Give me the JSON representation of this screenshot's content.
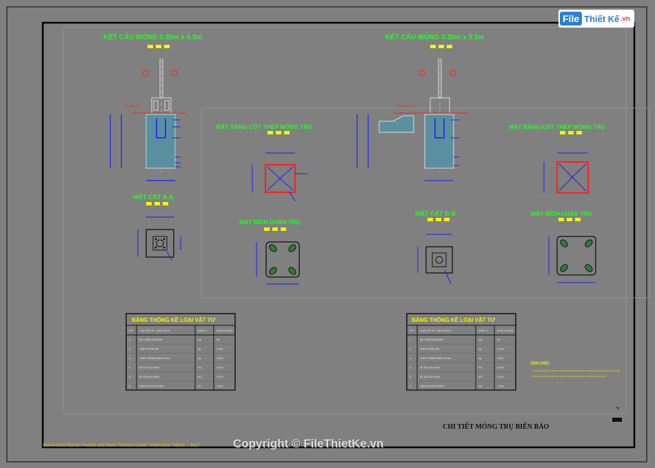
{
  "logo": {
    "brand_a": "File",
    "brand_b": "Thiết Kế",
    "brand_c": ".vn"
  },
  "watermark": "Copyright © FileThietKe.vn",
  "footer_title": "CHI TIẾT MÓNG TRỤ BIỂN BÁO",
  "status_line": "\\Ref H:\\NGUYEN BA THANG 2017\\DAU TIENG\\3 CONG TRINH DAU TIENG ... 2017",
  "left_sheet": {
    "title": "KẾT CẤU MÓNG 0.35m x 0.3m",
    "section_aa": "MẶT CẮT A-A",
    "plan_rebar": "MẶT BẰNG CỐT THÉP MÓNG TRỤ",
    "plan_base": "MẶT BÍCH CHÂN TRỤ",
    "table_title": "BẢNG THỐNG KÊ LOẠI VẬT TƯ"
  },
  "right_sheet": {
    "title": "KẾT CẤU MÓNG 0.35m x 0.3m",
    "section_bb": "MẶT CẮT B-B",
    "plan_rebar": "MẶT BẰNG CỐT THÉP MÓNG TRỤ",
    "plan_base": "MẶT BÍCH CHÂN TRỤ",
    "table_title": "BẢNG THỐNG KÊ LOẠI VẬT TƯ",
    "notes_title": "GHI CHÚ:"
  },
  "table_headers": [
    "STT",
    "LOẠI VẬT TƯ - QUY CÁCH",
    "ĐƠN VỊ",
    "KHỐI LƯỢNG"
  ],
  "table_rows": [
    [
      "1",
      "BU LONG M14x250",
      "cái",
      "04"
    ],
    [
      "2",
      "THÉP TRÒN Ø6",
      "kg",
      "0.499"
    ],
    [
      "3",
      "THÉP TRÁNG BẢN 10mm",
      "kg",
      "4.531"
    ],
    [
      "4",
      "BT ĐÁ 1x2 M200",
      "m3",
      "0.024"
    ],
    [
      "5",
      "BT ĐÁ 1x2 M150",
      "m3",
      "0.013"
    ],
    [
      "6",
      "VÁN KHUÔN MÓNG",
      "m2",
      "1.260"
    ]
  ],
  "colors": {
    "background": "#808080",
    "frame": "#111111",
    "yellow": "#f5f500",
    "green": "#20ff20",
    "blue": "#1a1aff",
    "red": "#ff2020",
    "cyan": "#00e5e5"
  }
}
